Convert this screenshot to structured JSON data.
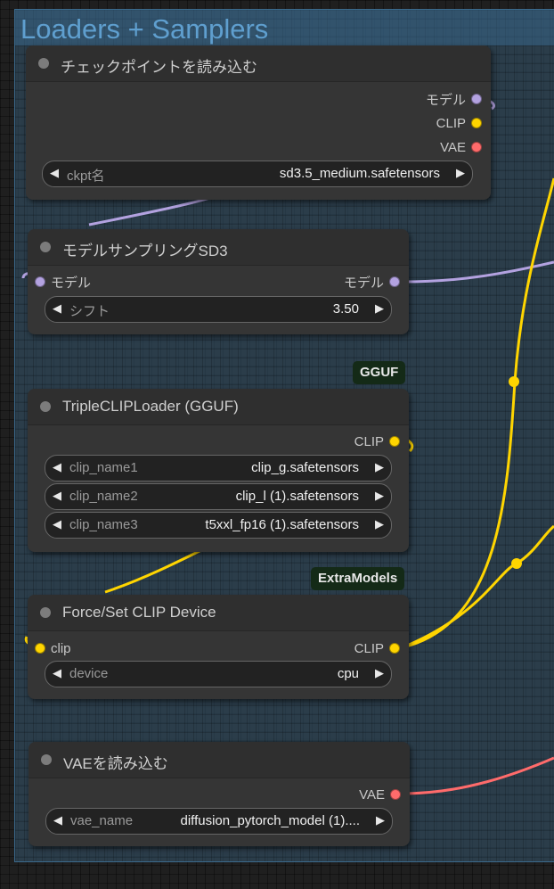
{
  "group": {
    "title": "Loaders + Samplers"
  },
  "colors": {
    "model": "#b3a2e0",
    "clip": "#ffd500",
    "vae": "#ff6b6b",
    "group_bg": "#35556e"
  },
  "nodes": {
    "checkpoint": {
      "title": "チェックポイントを読み込む",
      "outputs": [
        "モデル",
        "CLIP",
        "VAE"
      ],
      "widget": {
        "name": "ckpt名",
        "value": "sd3.5_medium.safetensors"
      }
    },
    "sampling": {
      "title": "モデルサンプリングSD3",
      "input": "モデル",
      "output": "モデル",
      "widget": {
        "name": "シフト",
        "value": "3.50"
      }
    },
    "triple_clip": {
      "badge": "GGUF",
      "title": "TripleCLIPLoader (GGUF)",
      "output": "CLIP",
      "widgets": [
        {
          "name": "clip_name1",
          "value": "clip_g.safetensors"
        },
        {
          "name": "clip_name2",
          "value": "clip_l (1).safetensors"
        },
        {
          "name": "clip_name3",
          "value": "t5xxl_fp16 (1).safetensors"
        }
      ]
    },
    "clip_device": {
      "badge": "ExtraModels",
      "title": "Force/Set CLIP Device",
      "input": "clip",
      "output": "CLIP",
      "widget": {
        "name": "device",
        "value": "cpu"
      }
    },
    "vae": {
      "title": "VAEを読み込む",
      "output": "VAE",
      "widget": {
        "name": "vae_name",
        "value": "diffusion_pytorch_model (1)...."
      }
    }
  }
}
